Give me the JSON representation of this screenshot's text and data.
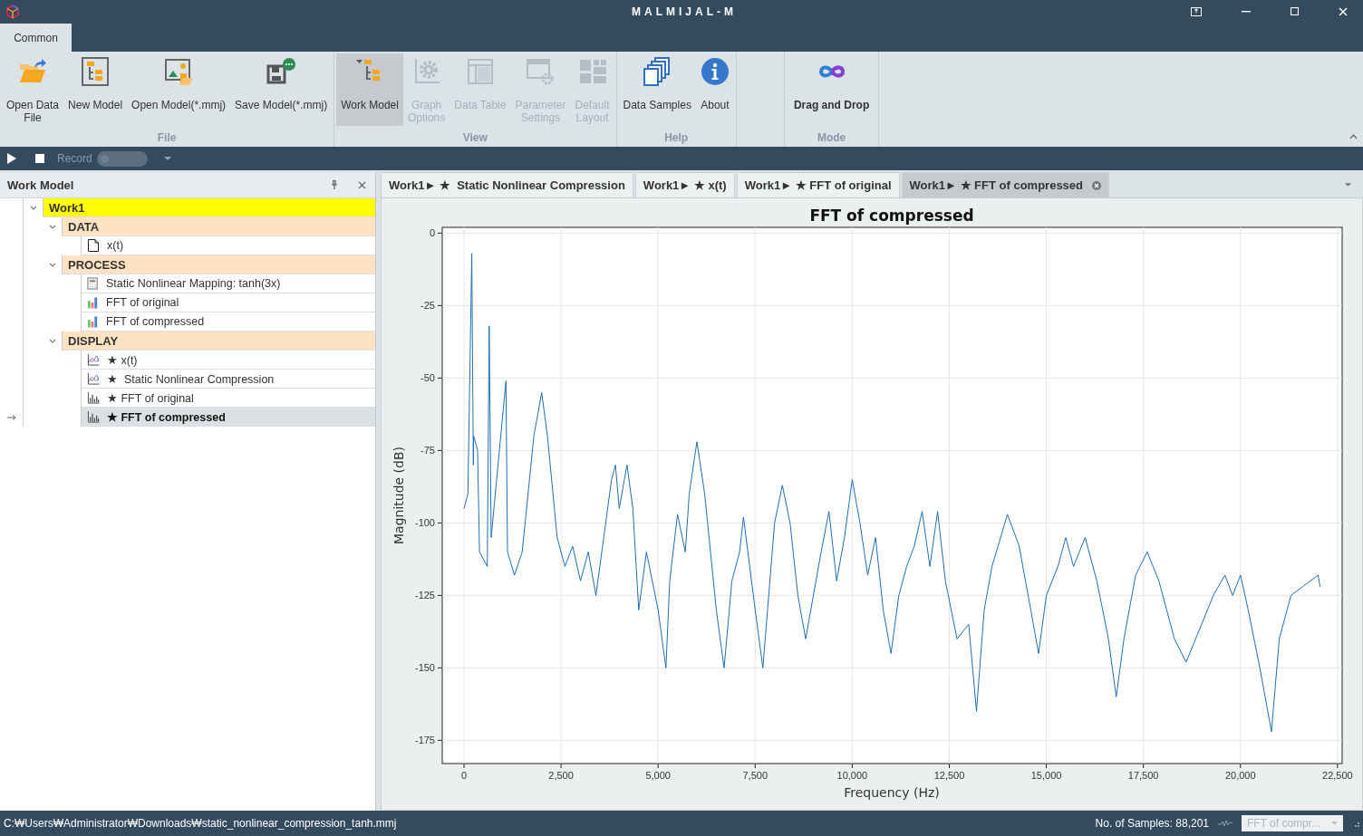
{
  "window": {
    "title": "MALMIJAL-M"
  },
  "ribbon_tabs": [
    {
      "label": "Common",
      "selected": true
    }
  ],
  "ribbon_groups": [
    {
      "label": "File",
      "buttons": [
        {
          "label": [
            "Open Data",
            "File"
          ],
          "kind": "open-folder",
          "disabled": false,
          "selected": false
        },
        {
          "label": [
            "New Model"
          ],
          "kind": "new-model",
          "disabled": false,
          "selected": false
        },
        {
          "label": [
            "Open Model(*.mmj)"
          ],
          "kind": "open-model",
          "disabled": false,
          "selected": false
        },
        {
          "label": [
            "Save Model(*.mmj)"
          ],
          "kind": "save",
          "disabled": false,
          "selected": false
        }
      ]
    },
    {
      "label": "View",
      "buttons": [
        {
          "label": [
            "Work Model"
          ],
          "kind": "tree",
          "disabled": false,
          "selected": true
        },
        {
          "label": [
            "Graph",
            "Options"
          ],
          "kind": "gear",
          "disabled": true,
          "selected": false
        },
        {
          "label": [
            "Data Table"
          ],
          "kind": "table",
          "disabled": true,
          "selected": false
        },
        {
          "label": [
            "Parameter",
            "Settings"
          ],
          "kind": "settings",
          "disabled": true,
          "selected": false
        },
        {
          "label": [
            "Default",
            "Layout"
          ],
          "kind": "layout",
          "disabled": true,
          "selected": false
        }
      ]
    },
    {
      "label": "Help",
      "buttons": [
        {
          "label": [
            "Data Samples"
          ],
          "kind": "pages",
          "disabled": false,
          "selected": false
        },
        {
          "label": [
            "About"
          ],
          "kind": "info",
          "disabled": false,
          "selected": false
        }
      ]
    },
    {
      "label": "Mode",
      "buttons": [
        {
          "label": [
            "Drag and Drop"
          ],
          "kind": "infinity",
          "disabled": false,
          "selected": false
        }
      ]
    }
  ],
  "toolbar": {
    "record": {
      "label": "Record",
      "on": false
    }
  },
  "work_model": {
    "title": "Work Model",
    "tree": [
      {
        "label": "Work1",
        "kind": "root",
        "expanded": true,
        "selected": false,
        "children": [
          {
            "label": "DATA",
            "kind": "group",
            "expanded": true,
            "selected": false,
            "children": [
              {
                "label": "x(t)",
                "kind": "file",
                "selected": false
              }
            ]
          },
          {
            "label": "PROCESS",
            "kind": "group",
            "expanded": true,
            "selected": false,
            "children": [
              {
                "label": "Static Nonlinear Mapping: tanh(3x)",
                "kind": "calc",
                "selected": false
              },
              {
                "label": "FFT of original",
                "kind": "bars",
                "selected": false
              },
              {
                "label": "FFT of compressed",
                "kind": "bars",
                "selected": false
              }
            ]
          },
          {
            "label": "DISPLAY",
            "kind": "group",
            "expanded": true,
            "selected": false,
            "children": [
              {
                "label": "★ x(t)",
                "kind": "plot",
                "selected": false
              },
              {
                "label": "★  Static Nonlinear Compression",
                "kind": "plot",
                "selected": false
              },
              {
                "label": "★ FFT of original",
                "kind": "hist",
                "selected": false
              },
              {
                "label": "★ FFT of compressed",
                "kind": "hist",
                "selected": true
              }
            ]
          }
        ]
      }
    ]
  },
  "doc_tabs": [
    {
      "label": "Work1► ★  Static Nonlinear Compression",
      "selected": false
    },
    {
      "label": "Work1► ★ x(t)",
      "selected": false
    },
    {
      "label": "Work1► ★ FFT of original",
      "selected": false
    },
    {
      "label": "Work1► ★ FFT of compressed",
      "selected": true
    }
  ],
  "chart_data": {
    "type": "line",
    "grid": true,
    "title": "FFT of compressed",
    "xlabel": "Frequency (Hz)",
    "ylabel": "Magnitude (dB)",
    "xlim": [
      -560,
      22620
    ],
    "ylim": [
      -183,
      2
    ],
    "xticks": [
      0,
      {
        "value": 2500,
        "label": "2,500"
      },
      {
        "value": 5000,
        "label": "5,000"
      },
      {
        "value": 7500,
        "label": "7,500"
      },
      {
        "value": 10000,
        "label": "10,000"
      },
      {
        "value": 12500,
        "label": "12,500"
      },
      {
        "value": 15000,
        "label": "15,000"
      },
      {
        "value": 17500,
        "label": "17,500"
      },
      {
        "value": 20000,
        "label": "20,000"
      },
      {
        "value": 22500,
        "label": "22,500"
      }
    ],
    "yticks": [
      0,
      -25,
      -50,
      -75,
      -100,
      -125,
      -150,
      -175
    ],
    "x": [
      0,
      100,
      200,
      240,
      250,
      350,
      400,
      600,
      650,
      700,
      1080,
      1120,
      1300,
      1500,
      1800,
      2000,
      2150,
      2400,
      2600,
      2800,
      3000,
      3200,
      3400,
      3600,
      3800,
      3900,
      4000,
      4200,
      4350,
      4500,
      4700,
      5000,
      5200,
      5300,
      5500,
      5700,
      5800,
      6000,
      6200,
      6500,
      6700,
      6900,
      7100,
      7200,
      7500,
      7700,
      8000,
      8200,
      8400,
      8600,
      8800,
      9000,
      9200,
      9400,
      9600,
      9800,
      10000,
      10200,
      10400,
      10600,
      10800,
      11000,
      11200,
      11400,
      11600,
      11800,
      12000,
      12200,
      12400,
      12700,
      13000,
      13200,
      13400,
      13600,
      14000,
      14300,
      14600,
      14800,
      15000,
      15300,
      15500,
      15700,
      16000,
      16300,
      16600,
      16800,
      17000,
      17300,
      17600,
      17900,
      18300,
      18600,
      19000,
      19300,
      19600,
      19800,
      20000,
      20200,
      20500,
      20800,
      21000,
      21300,
      21600,
      22000,
      22050
    ],
    "values": [
      -95,
      -90,
      -7,
      -80,
      -70,
      -75,
      -110,
      -115,
      -32,
      -105,
      -51,
      -110,
      -118,
      -110,
      -70,
      -55,
      -70,
      -105,
      -115,
      -108,
      -120,
      -110,
      -125,
      -105,
      -85,
      -80,
      -95,
      -80,
      -95,
      -130,
      -110,
      -130,
      -150,
      -120,
      -97,
      -110,
      -90,
      -72,
      -90,
      -130,
      -150,
      -120,
      -110,
      -98,
      -130,
      -150,
      -100,
      -87,
      -100,
      -125,
      -140,
      -125,
      -110,
      -96,
      -120,
      -105,
      -85,
      -100,
      -118,
      -105,
      -130,
      -145,
      -125,
      -115,
      -108,
      -96,
      -115,
      -96,
      -120,
      -140,
      -135,
      -165,
      -130,
      -115,
      -97,
      -108,
      -130,
      -145,
      -125,
      -115,
      -105,
      -115,
      -105,
      -120,
      -140,
      -160,
      -140,
      -118,
      -110,
      -120,
      -140,
      -148,
      -135,
      -125,
      -118,
      -125,
      -118,
      -130,
      -150,
      -172,
      -140,
      -125,
      -122,
      -118,
      -122
    ]
  },
  "status_bar": {
    "path": "C:₩Users₩Administrator₩Downloads₩static_nonlinear_compression_tanh.mmj",
    "samples": "No. of Samples: 88,201",
    "view_select": "FFT of compr..."
  }
}
